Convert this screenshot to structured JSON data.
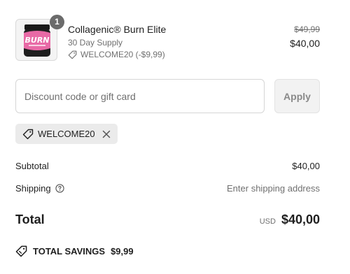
{
  "product": {
    "quantity": "1",
    "name": "Collagenic® Burn Elite",
    "variant": "30 Day Supply",
    "discount_label": "WELCOME20 (-$9,99)",
    "original_price": "$49,99",
    "price": "$40,00",
    "image_label": "BURN"
  },
  "discount": {
    "placeholder": "Discount code or gift card",
    "value": "",
    "apply_label": "Apply"
  },
  "applied_code": {
    "code": "WELCOME20"
  },
  "summary": {
    "subtotal_label": "Subtotal",
    "subtotal_value": "$40,00",
    "shipping_label": "Shipping",
    "shipping_value": "Enter shipping address",
    "total_label": "Total",
    "currency": "USD",
    "total_value": "$40,00",
    "savings_label": "TOTAL SAVINGS",
    "savings_value": "$9,99"
  },
  "icons": {
    "tag": "tag-icon",
    "close": "close-icon",
    "help": "help-circle-icon",
    "savings": "savings-tag-icon"
  },
  "colors": {
    "text": "#1f1f1f",
    "muted": "#707070",
    "badge": "#6b6b6b",
    "chip_bg": "#ebebeb",
    "product_pink": "#e86aa6"
  }
}
